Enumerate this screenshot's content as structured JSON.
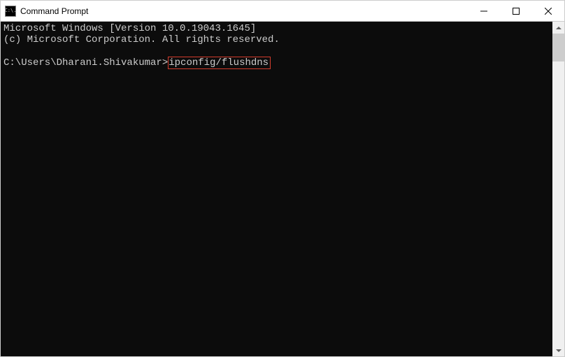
{
  "window": {
    "title": "Command Prompt",
    "icon_label": "C:\\."
  },
  "terminal": {
    "line1": "Microsoft Windows [Version 10.0.19043.1645]",
    "line2": "(c) Microsoft Corporation. All rights reserved.",
    "prompt": "C:\\Users\\Dharani.Shivakumar>",
    "command": "ipconfig/flushdns"
  }
}
